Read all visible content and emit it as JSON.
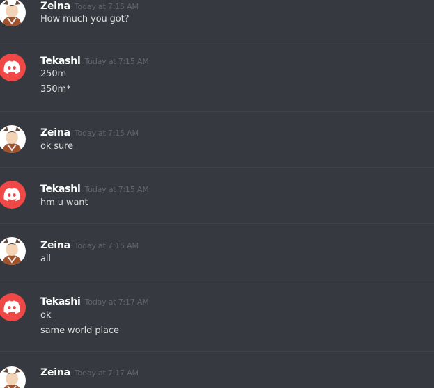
{
  "colors": {
    "background": "#36393f",
    "divider": "#40434a",
    "username": "#ffffff",
    "timestamp": "#63666c",
    "text": "#dcddde",
    "discord_avatar": "#f04747"
  },
  "messages": [
    {
      "author": "Zeina",
      "avatar": "zeina-avatar",
      "timestamp": "Today at 7:15 AM",
      "lines": [
        "How much you got?"
      ]
    },
    {
      "author": "Tekashi",
      "avatar": "discord-logo-icon",
      "timestamp": "Today at 7:15 AM",
      "lines": [
        "250m",
        "350m*"
      ]
    },
    {
      "author": "Zeina",
      "avatar": "zeina-avatar",
      "timestamp": "Today at 7:15 AM",
      "lines": [
        "ok sure"
      ]
    },
    {
      "author": "Tekashi",
      "avatar": "discord-logo-icon",
      "timestamp": "Today at 7:15 AM",
      "lines": [
        "hm u want"
      ]
    },
    {
      "author": "Zeina",
      "avatar": "zeina-avatar",
      "timestamp": "Today at 7:15 AM",
      "lines": [
        "all"
      ]
    },
    {
      "author": "Tekashi",
      "avatar": "discord-logo-icon",
      "timestamp": "Today at 7:17 AM",
      "lines": [
        "ok",
        "same world place"
      ]
    },
    {
      "author": "Zeina",
      "avatar": "zeina-avatar",
      "timestamp": "Today at 7:17 AM",
      "lines": []
    }
  ]
}
